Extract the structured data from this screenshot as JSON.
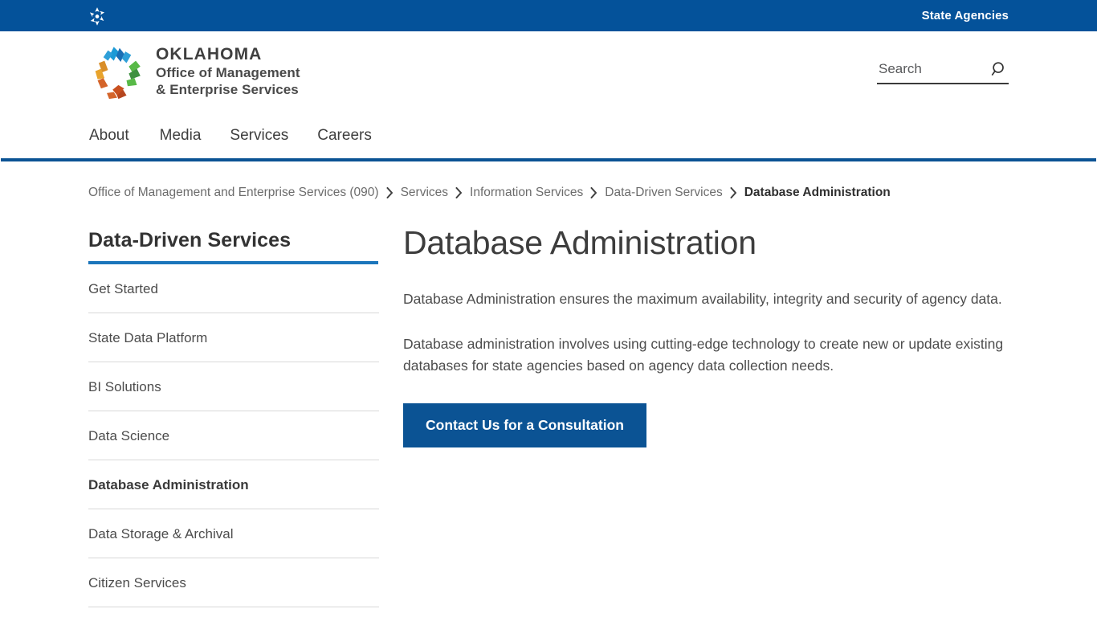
{
  "topbar": {
    "emblem_icon": "oklahoma-star-emblem-icon",
    "state_agencies_label": "State Agencies"
  },
  "header": {
    "logo_icon": "oklahoma-pinwheel-logo-icon",
    "logo_line1": "OKLAHOMA",
    "logo_line2": "Office of Management",
    "logo_line3": "& Enterprise Services",
    "search": {
      "value": "",
      "placeholder": "Search",
      "icon": "search-icon"
    }
  },
  "nav": {
    "items": [
      {
        "label": "About"
      },
      {
        "label": "Media"
      },
      {
        "label": "Services"
      },
      {
        "label": "Careers"
      }
    ]
  },
  "breadcrumb": {
    "separator_icon": "chevron-right-icon",
    "items": [
      {
        "label": "Office of Management and Enterprise Services (090)",
        "current": false
      },
      {
        "label": "Services",
        "current": false
      },
      {
        "label": "Information Services",
        "current": false
      },
      {
        "label": "Data-Driven Services",
        "current": false
      },
      {
        "label": "Database Administration",
        "current": true
      }
    ]
  },
  "sidebar": {
    "title": "Data-Driven Services",
    "items": [
      {
        "label": "Get Started",
        "active": false
      },
      {
        "label": "State Data Platform",
        "active": false
      },
      {
        "label": "BI Solutions",
        "active": false
      },
      {
        "label": "Data Science",
        "active": false
      },
      {
        "label": "Database Administration",
        "active": true
      },
      {
        "label": "Data Storage & Archival",
        "active": false
      },
      {
        "label": "Citizen Services",
        "active": false
      }
    ]
  },
  "main": {
    "title": "Database Administration",
    "paragraph1": "Database Administration ensures the maximum availability, integrity and security of agency data.",
    "paragraph2": "Database administration involves using cutting-edge technology to create new or update existing databases for state agencies based on agency data collection needs.",
    "cta_label": "Contact Us for a Consultation"
  },
  "colors": {
    "header_blue": "#04529a",
    "nav_rule_blue": "#0b5394",
    "accent_blue": "#1b75bb",
    "button_blue": "#0b5394",
    "text_gray": "#4d4d4d"
  }
}
